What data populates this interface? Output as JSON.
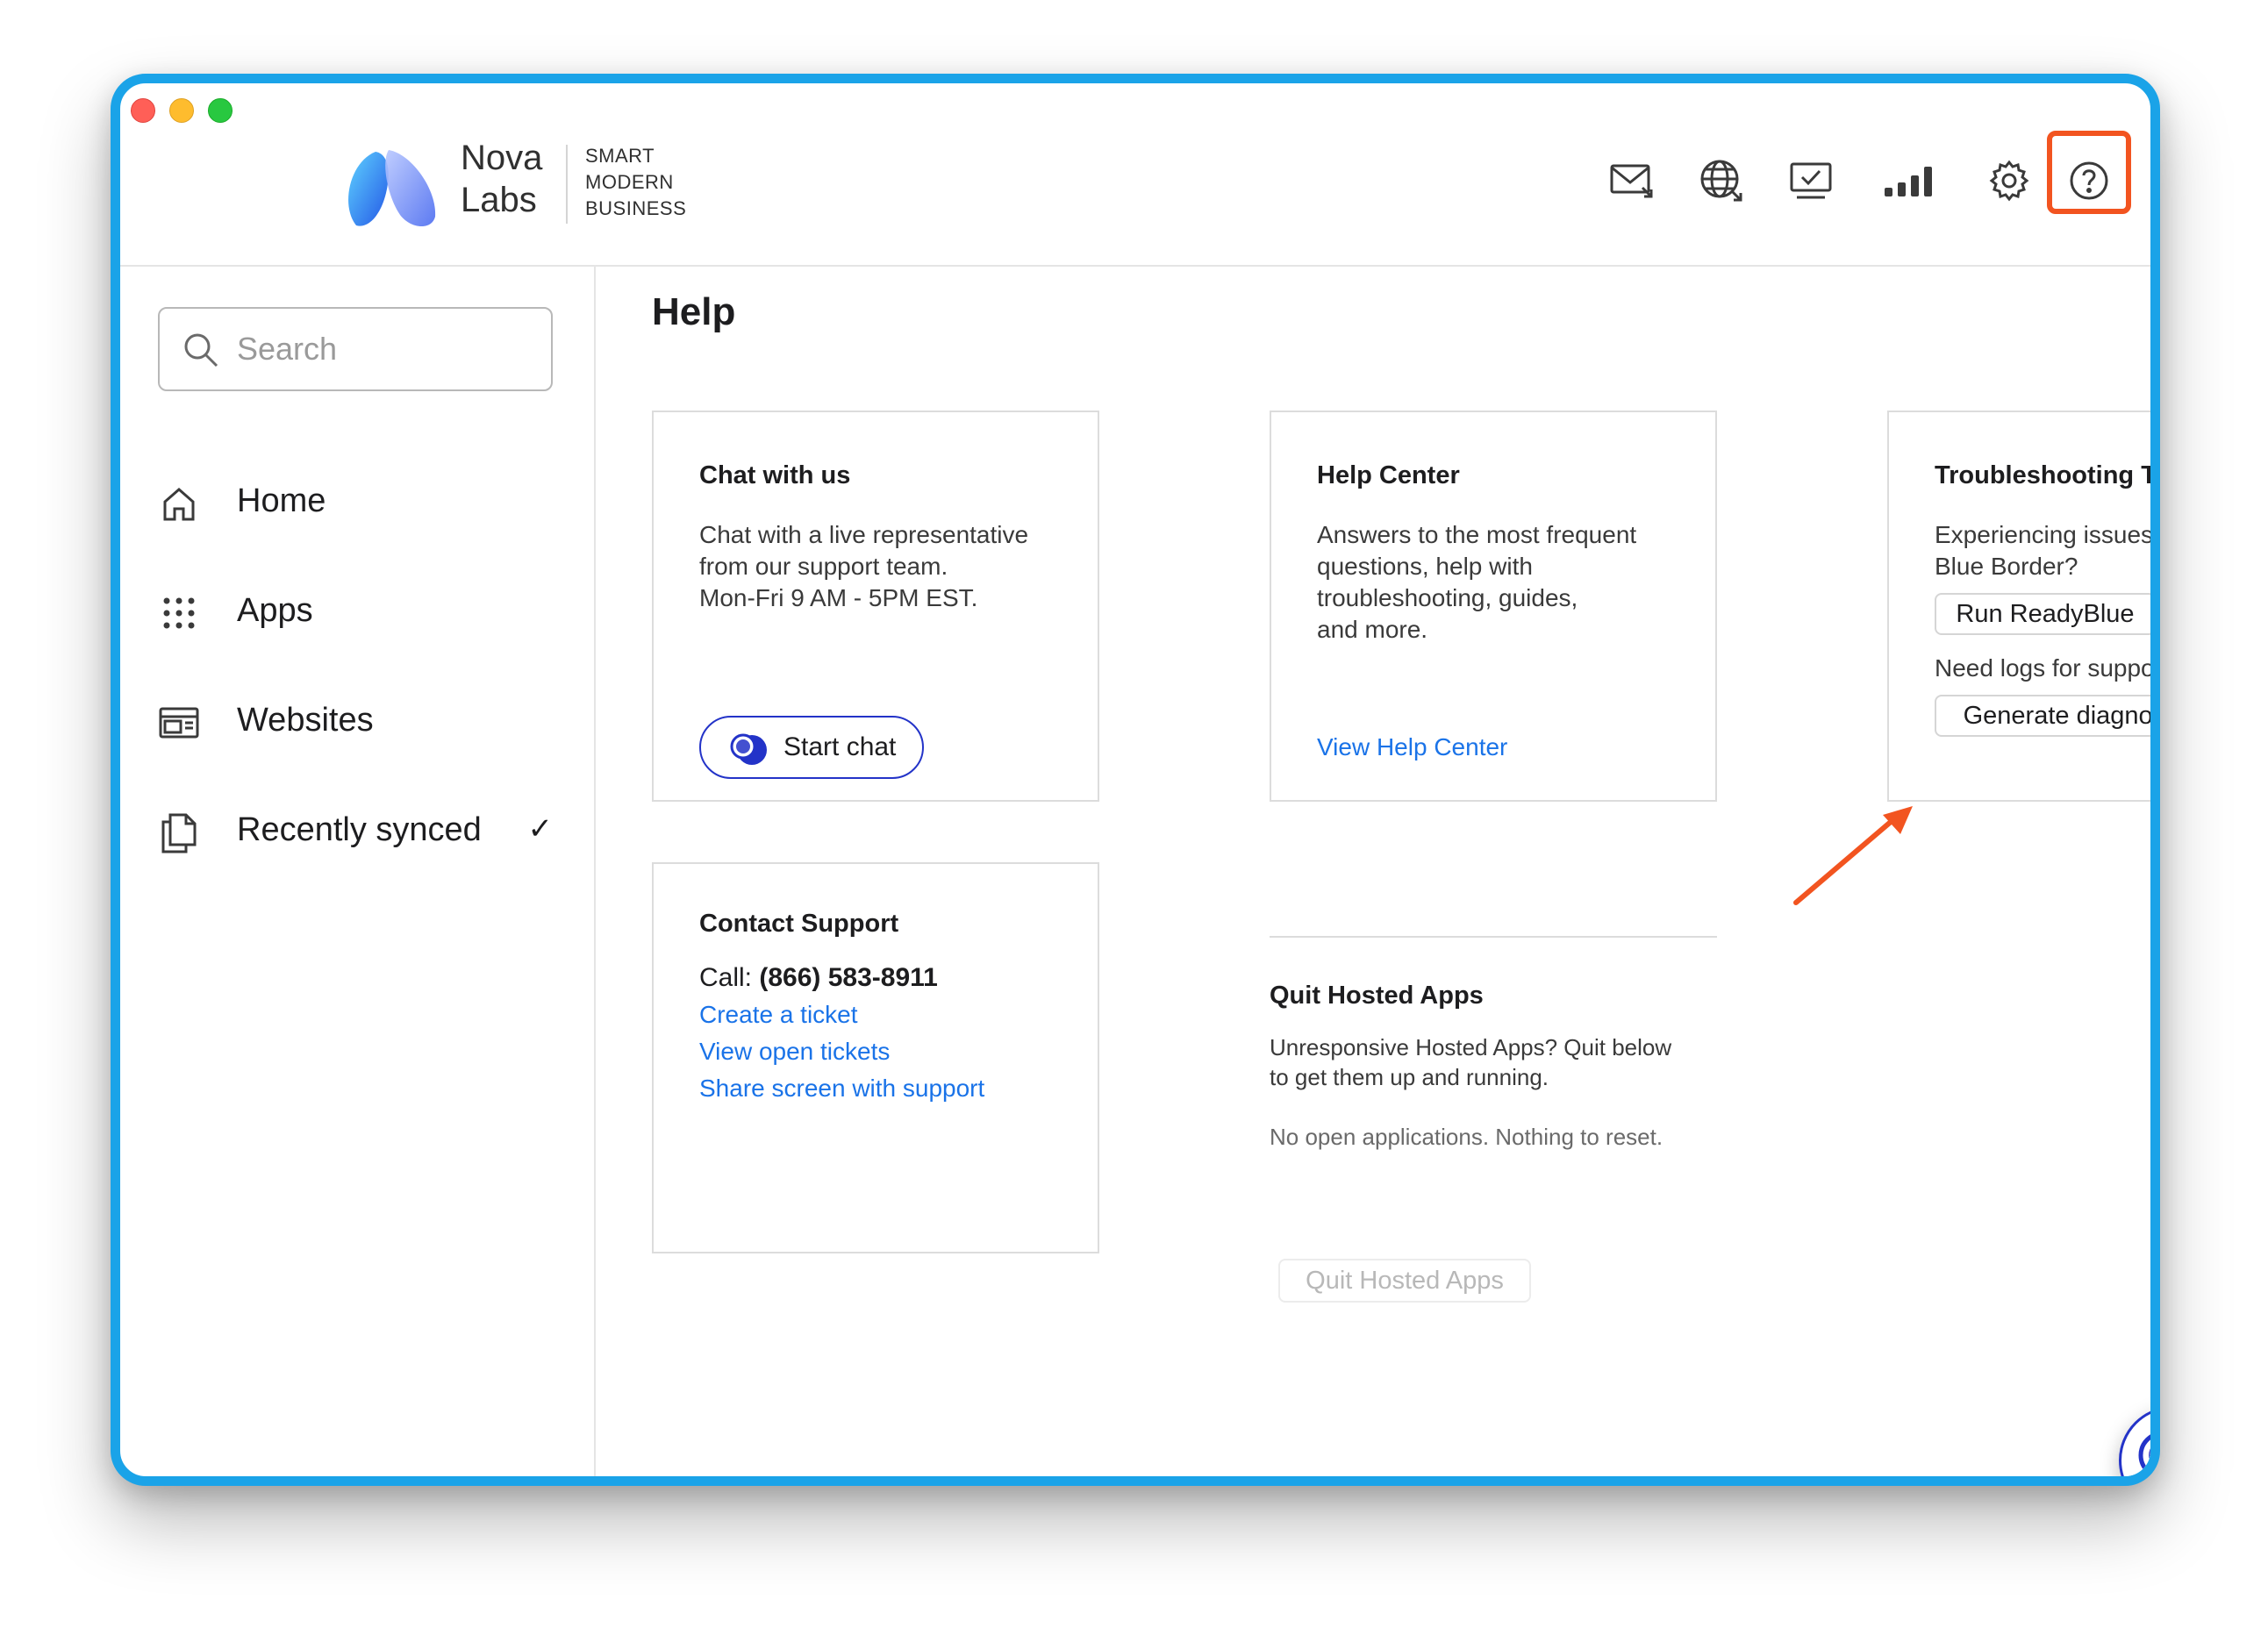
{
  "header": {
    "logo_line1": "Nova",
    "logo_line2": "Labs",
    "tagline1": "SMART",
    "tagline2": "MODERN",
    "tagline3": "BUSINESS",
    "icons": [
      "mail-icon",
      "globe-icon",
      "monitor-check-icon",
      "signal-bars-icon",
      "gear-icon",
      "help-icon"
    ]
  },
  "sidebar": {
    "search_placeholder": "Search",
    "items": [
      {
        "label": "Home",
        "icon": "home-icon"
      },
      {
        "label": "Apps",
        "icon": "grid-icon"
      },
      {
        "label": "Websites",
        "icon": "browser-window-icon"
      },
      {
        "label": "Recently synced",
        "icon": "documents-icon",
        "check": "✓"
      }
    ]
  },
  "main": {
    "title": "Help",
    "chat": {
      "title": "Chat with us",
      "line1": "Chat with a live representative",
      "line2": "from our support team.",
      "line3": "Mon-Fri 9 AM - 5PM EST.",
      "button": "Start chat"
    },
    "help_center": {
      "title": "Help Center",
      "line1": "Answers to the most frequent",
      "line2": "questions, help with",
      "line3": "troubleshooting, guides,",
      "line4": "and more.",
      "link": "View Help Center"
    },
    "troubleshooting": {
      "title": "Troubleshooting Tools",
      "line1": "Experiencing issues with",
      "line2": "Blue Border?",
      "button1": "Run ReadyBlue",
      "line3": "Need logs for support?",
      "button2": "Generate diagnostic logs"
    },
    "contact": {
      "title": "Contact Support",
      "call_label": "Call:",
      "call_number": "(866) 583-8911",
      "link1": "Create a ticket",
      "link2": "View open tickets",
      "link3": "Share screen with support"
    },
    "quit": {
      "title": "Quit Hosted Apps",
      "line1": "Unresponsive Hosted Apps? Quit below",
      "line2": "to get them up and running.",
      "status": "No open applications. Nothing to reset.",
      "button": "Quit Hosted Apps"
    }
  },
  "colors": {
    "window_border": "#1aa3e8",
    "highlight": "#f25420",
    "link": "#1a73e8",
    "brand_blue": "#2333c8"
  }
}
